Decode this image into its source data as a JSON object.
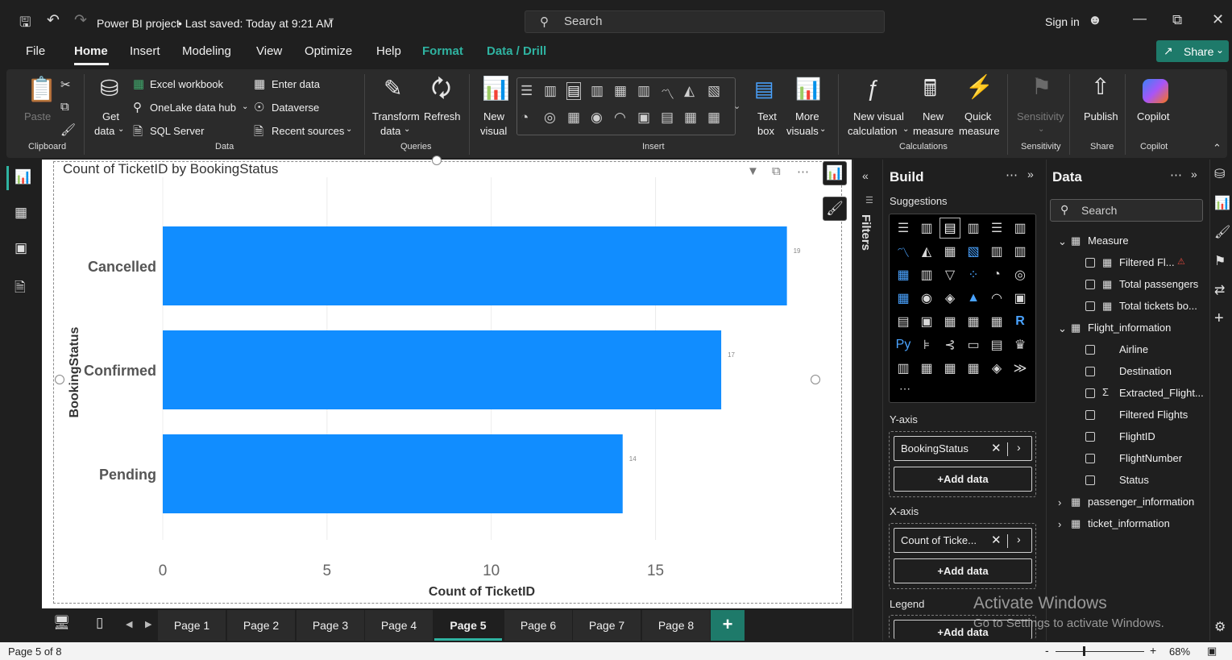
{
  "titlebar": {
    "app_title": "Power BI project",
    "saved_status": "• Last saved: Today at 9:21 AM",
    "search_placeholder": "Search",
    "sign_in": "Sign in"
  },
  "menu": {
    "items": [
      "File",
      "Home",
      "Insert",
      "Modeling",
      "View",
      "Optimize",
      "Help",
      "Format",
      "Data / Drill"
    ],
    "active": "Home",
    "share": "Share"
  },
  "ribbon": {
    "clipboard": {
      "paste": "Paste",
      "group": "Clipboard"
    },
    "data": {
      "get_data_1": "Get",
      "get_data_2": "data",
      "excel": "Excel workbook",
      "onelake": "OneLake data hub",
      "sql": "SQL Server",
      "enter_data": "Enter data",
      "dataverse": "Dataverse",
      "recent": "Recent sources",
      "group": "Data"
    },
    "queries": {
      "transform_1": "Transform",
      "transform_2": "data",
      "refresh": "Refresh",
      "group": "Queries"
    },
    "insert": {
      "new_visual_1": "New",
      "new_visual_2": "visual",
      "text_box_1": "Text",
      "text_box_2": "box",
      "more_visuals_1": "More",
      "more_visuals_2": "visuals",
      "group": "Insert"
    },
    "calculations": {
      "new_visual_calc_1": "New visual",
      "new_visual_calc_2": "calculation",
      "new_measure_1": "New",
      "new_measure_2": "measure",
      "quick_measure_1": "Quick",
      "quick_measure_2": "measure",
      "group": "Calculations"
    },
    "sensitivity": {
      "label": "Sensitivity",
      "group": "Sensitivity"
    },
    "share": {
      "publish": "Publish",
      "group": "Share"
    },
    "copilot": {
      "label": "Copilot",
      "group": "Copilot"
    }
  },
  "visual": {
    "title": "Count of TicketID by BookingStatus"
  },
  "chart_data": {
    "type": "bar",
    "orientation": "horizontal",
    "title": "Count of TicketID by BookingStatus",
    "categories": [
      "Cancelled",
      "Confirmed",
      "Pending"
    ],
    "values": [
      19,
      17,
      14
    ],
    "data_labels": [
      "19",
      "17",
      "14"
    ],
    "xlabel": "Count of TicketID",
    "ylabel": "BookingStatus",
    "xticks": [
      "0",
      "5",
      "10",
      "15"
    ],
    "xlim": [
      0,
      19.5
    ],
    "grid": true,
    "bar_color": "#118dff"
  },
  "filters": {
    "label": "Filters"
  },
  "build": {
    "title": "Build",
    "suggestions": "Suggestions",
    "y_axis": "Y-axis",
    "y_field": "BookingStatus",
    "x_axis": "X-axis",
    "x_field": "Count of Ticke...",
    "add_data": "+Add data",
    "legend": "Legend",
    "legend_add": "+Add data"
  },
  "data_pane": {
    "title": "Data",
    "search_placeholder": "Search",
    "tree": [
      {
        "label": "Measure",
        "level": 0,
        "expanded": true
      },
      {
        "label": "Filtered Fl...",
        "level": 1
      },
      {
        "label": "Total passengers",
        "level": 1
      },
      {
        "label": "Total tickets bo...",
        "level": 1
      },
      {
        "label": "Flight_information",
        "level": 0,
        "expanded": true
      },
      {
        "label": "Airline",
        "level": 1
      },
      {
        "label": "Destination",
        "level": 1
      },
      {
        "label": "Extracted_Flight...",
        "level": 1
      },
      {
        "label": "Filtered Flights",
        "level": 1
      },
      {
        "label": "FlightID",
        "level": 1
      },
      {
        "label": "FlightNumber",
        "level": 1
      },
      {
        "label": "Status",
        "level": 1
      },
      {
        "label": "passenger_information",
        "level": 0,
        "expanded": false
      },
      {
        "label": "ticket_information",
        "level": 0,
        "expanded": false
      }
    ]
  },
  "pages": {
    "tabs": [
      "Page 1",
      "Page 2",
      "Page 3",
      "Page 4",
      "Page 5",
      "Page 6",
      "Page 7",
      "Page 8"
    ],
    "active": "Page 5",
    "add": "+"
  },
  "status": {
    "page_info": "Page 5 of 8",
    "zoom": "68%"
  },
  "watermark": {
    "line1": "Activate Windows",
    "line2": "Go to Settings to activate Windows."
  }
}
